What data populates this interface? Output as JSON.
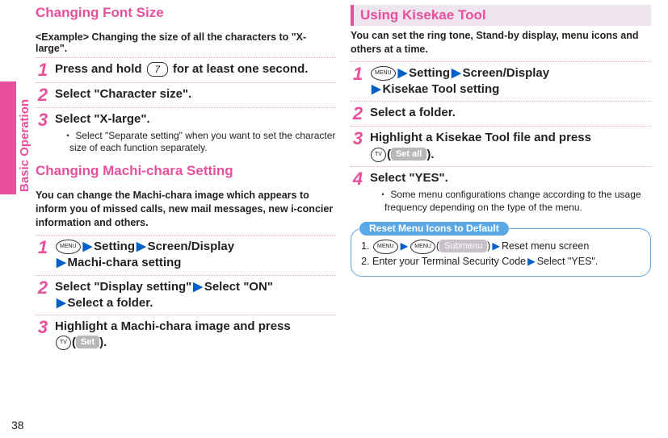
{
  "page_number": "38",
  "side_label": "Basic Operation",
  "left": {
    "section1": {
      "title": "Changing Font Size",
      "example": "<Example> Changing the size of all the characters to \"X-large\".",
      "steps": [
        {
          "num": "1",
          "pre": "Press and hold ",
          "key": "7",
          "post": " for at least one second."
        },
        {
          "num": "2",
          "text": "Select \"Character size\"."
        },
        {
          "num": "3",
          "text": "Select \"X-large\".",
          "note": "・ Select \"Separate setting\" when you want to set the character size of each function separately."
        }
      ]
    },
    "section2": {
      "title": "Changing Machi-chara Setting",
      "intro": "You can change the Machi-chara image which appears to inform you of missed calls, new mail messages, new i-concier information and others.",
      "steps": [
        {
          "num": "1",
          "chip": "MENU",
          "s1": "Setting",
          "s2": "Screen/Display",
          "s3": "Machi-chara setting"
        },
        {
          "num": "2",
          "a": "Select \"Display setting\"",
          "b": "Select \"ON\"",
          "c": "Select a folder."
        },
        {
          "num": "3",
          "text": "Highlight a Machi-chara image and press ",
          "chip2": "TV",
          "pill": "Set",
          "after": ")."
        }
      ]
    }
  },
  "right": {
    "section1": {
      "title": "Using Kisekae Tool",
      "intro": "You can set the ring tone, Stand-by display, menu icons and others at a time.",
      "steps": [
        {
          "num": "1",
          "chip": "MENU",
          "s1": "Setting",
          "s2": "Screen/Display",
          "s3": "Kisekae Tool setting"
        },
        {
          "num": "2",
          "text": "Select a folder."
        },
        {
          "num": "3",
          "text": "Highlight a Kisekae Tool file and press ",
          "chip2": "TV",
          "pill": "Set all",
          "after": ")."
        },
        {
          "num": "4",
          "text": "Select \"YES\".",
          "note": "・ Some menu configurations change according to the usage frequency depending on the type of the menu."
        }
      ]
    },
    "callout": {
      "title": "Reset Menu Icons to Default",
      "line1_after": "Reset menu screen",
      "pill": "Submenu",
      "line2_a": "Enter your Terminal Security Code",
      "line2_b": "Select \"YES\"."
    }
  }
}
